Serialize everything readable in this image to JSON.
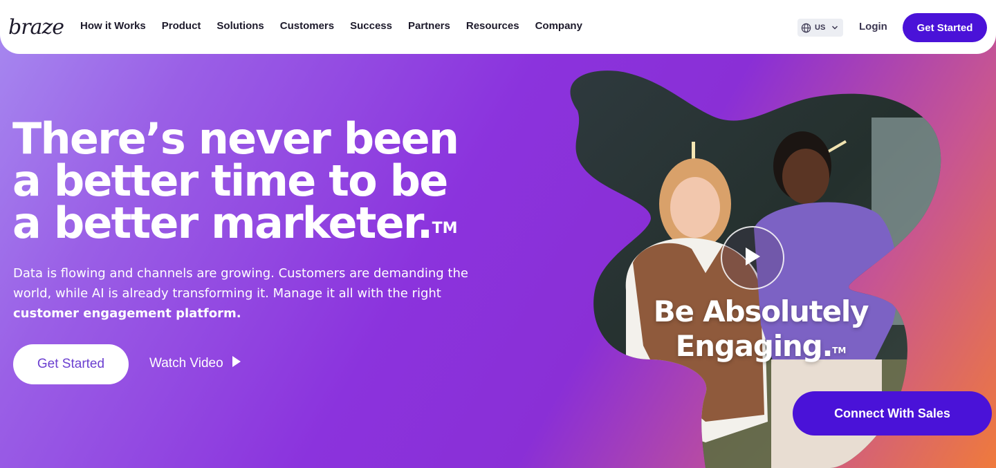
{
  "nav": {
    "logo_text": "braze",
    "links": [
      "How it Works",
      "Product",
      "Solutions",
      "Customers",
      "Success",
      "Partners",
      "Resources",
      "Company"
    ],
    "locale": "US",
    "login_label": "Login",
    "cta_label": "Get Started"
  },
  "hero": {
    "headline_lines": [
      "There’s never been",
      "a better time to be",
      "a better marketer."
    ],
    "headline_tm": "TM",
    "subtext_plain": "Data is flowing and channels are growing. Customers are demanding the world, while AI is already transforming it. Manage it all with the right",
    "subtext_bold": "customer engagement platform.",
    "cta_label": "Get Started",
    "watch_label": "Watch Video"
  },
  "video": {
    "caption_lines": [
      "Be Absolutely",
      "Engaging."
    ],
    "caption_tm": "TM"
  },
  "sales_cta_label": "Connect With Sales",
  "colors": {
    "brand_purple": "#4a12d8",
    "nav_text": "#1d1a2b"
  },
  "icons": {
    "locale": "globe-icon",
    "dropdown": "chevron-down-icon",
    "watch": "play-icon",
    "video": "play-icon"
  }
}
